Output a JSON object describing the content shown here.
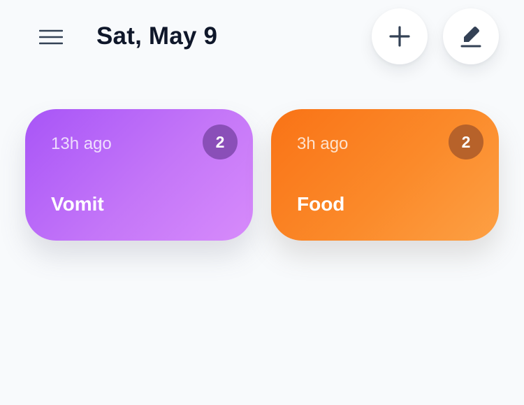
{
  "header": {
    "title": "Sat, May 9",
    "menu_icon": "hamburger-menu-icon",
    "add_icon": "plus-icon",
    "edit_icon": "pencil-icon"
  },
  "cards": [
    {
      "id": "vomit",
      "time_ago": "13h ago",
      "label": "Vomit",
      "count": "2",
      "gradient": [
        "#a855f7",
        "#d78bfb"
      ],
      "badge_color": "#8a4fb8"
    },
    {
      "id": "food",
      "time_ago": "3h ago",
      "label": "Food",
      "count": "2",
      "gradient": [
        "#f97316",
        "#fda044"
      ],
      "badge_color": "#b7622a"
    }
  ],
  "colors": {
    "background": "#f8fafc",
    "title": "#0f172a",
    "icon": "#334155"
  }
}
